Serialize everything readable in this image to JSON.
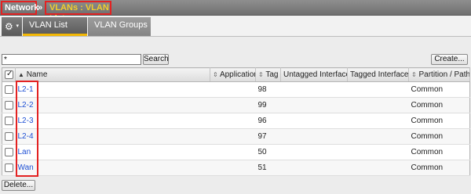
{
  "breadcrumb": {
    "section": "Network",
    "separator": "»",
    "page": "VLANs : VLAN List"
  },
  "toolbar": {
    "menu_icon": "gear-icon",
    "menu_caret": "▾",
    "tabs": [
      {
        "label": "VLAN List",
        "active": true
      },
      {
        "label": "VLAN Groups",
        "active": false
      }
    ]
  },
  "search": {
    "value": "*",
    "button_label": "Search"
  },
  "create_button": "Create...",
  "delete_button": "Delete...",
  "table": {
    "columns": {
      "name": "Name",
      "application": "Application",
      "tag": "Tag",
      "untagged": "Untagged Interfaces",
      "tagged": "Tagged Interfaces",
      "partition": "Partition / Path"
    },
    "rows": [
      {
        "name": "L2-1",
        "application": "",
        "tag": "98",
        "untagged": "",
        "tagged": "",
        "partition": "Common"
      },
      {
        "name": "L2-2",
        "application": "",
        "tag": "99",
        "untagged": "",
        "tagged": "",
        "partition": "Common"
      },
      {
        "name": "L2-3",
        "application": "",
        "tag": "96",
        "untagged": "",
        "tagged": "",
        "partition": "Common"
      },
      {
        "name": "L2-4",
        "application": "",
        "tag": "97",
        "untagged": "",
        "tagged": "",
        "partition": "Common"
      },
      {
        "name": "Lan",
        "application": "",
        "tag": "50",
        "untagged": "",
        "tagged": "",
        "partition": "Common"
      },
      {
        "name": "Wan",
        "application": "",
        "tag": "51",
        "untagged": "",
        "tagged": "",
        "partition": "Common"
      }
    ]
  },
  "colors": {
    "highlight": "#e32222",
    "active_tab_underline": "#f2b705",
    "link": "#1d4fd4"
  }
}
